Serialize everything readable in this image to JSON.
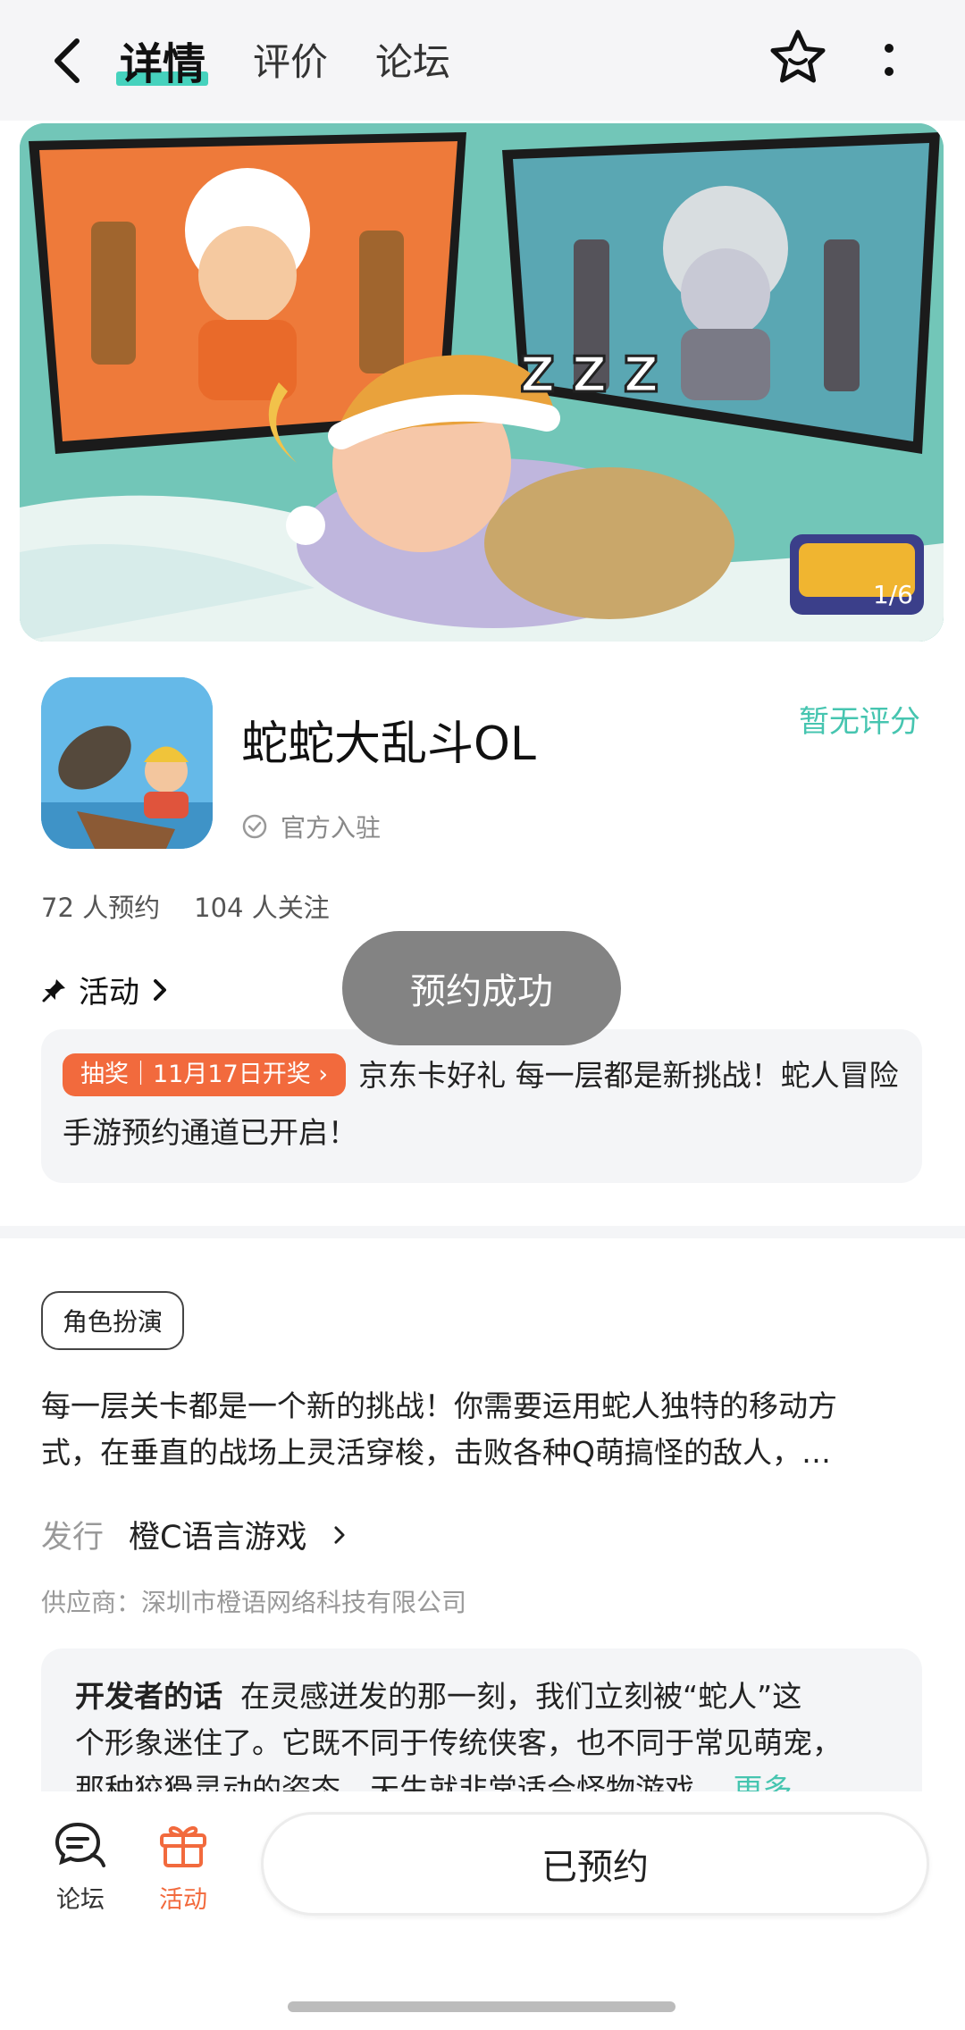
{
  "header": {
    "tabs": [
      "详情",
      "评价",
      "论坛"
    ],
    "active_tab": 0
  },
  "banner": {
    "page_indicator": "1/6"
  },
  "app": {
    "name": "蛇蛇大乱斗OL",
    "rating_text": "暂无评分",
    "official_label": "官方入驻",
    "reservations": "72 人预约",
    "followers": "104 人关注"
  },
  "activity": {
    "section_label": "活动",
    "badge": "抽奖｜11月17日开奖",
    "text": "京东卡好礼 每一层都是新挑战！蛇人冒险手游预约通道已开启！"
  },
  "toast": {
    "message": "预约成功"
  },
  "info": {
    "tag": "角色扮演",
    "description_line1": "每一层关卡都是一个新的挑战！你需要运用蛇人独特的移动方",
    "description_line2": "式，在垂直的战场上灵活穿梭，击败各种Q萌搞怪的敌人，…",
    "publisher_label": "发行",
    "publisher_name": "橙C语言游戏",
    "supplier": "供应商：深圳市橙语网络科技有限公司"
  },
  "developer": {
    "title": "开发者的话",
    "text_line1": "在灵感迸发的那一刻，我们立刻被“蛇人”这",
    "text_line2": "个形象迷住了。它既不同于传统侠客，也不同于常见萌宠，",
    "text_line3": "那种狡猾灵动的姿态，天生就非常适合怪物游戏。",
    "more": "更多"
  },
  "bottom_bar": {
    "forum_label": "论坛",
    "activity_label": "活动",
    "reserve_button": "已预约"
  },
  "colors": {
    "accent": "#46c5b0",
    "orange": "#f26a3d"
  }
}
